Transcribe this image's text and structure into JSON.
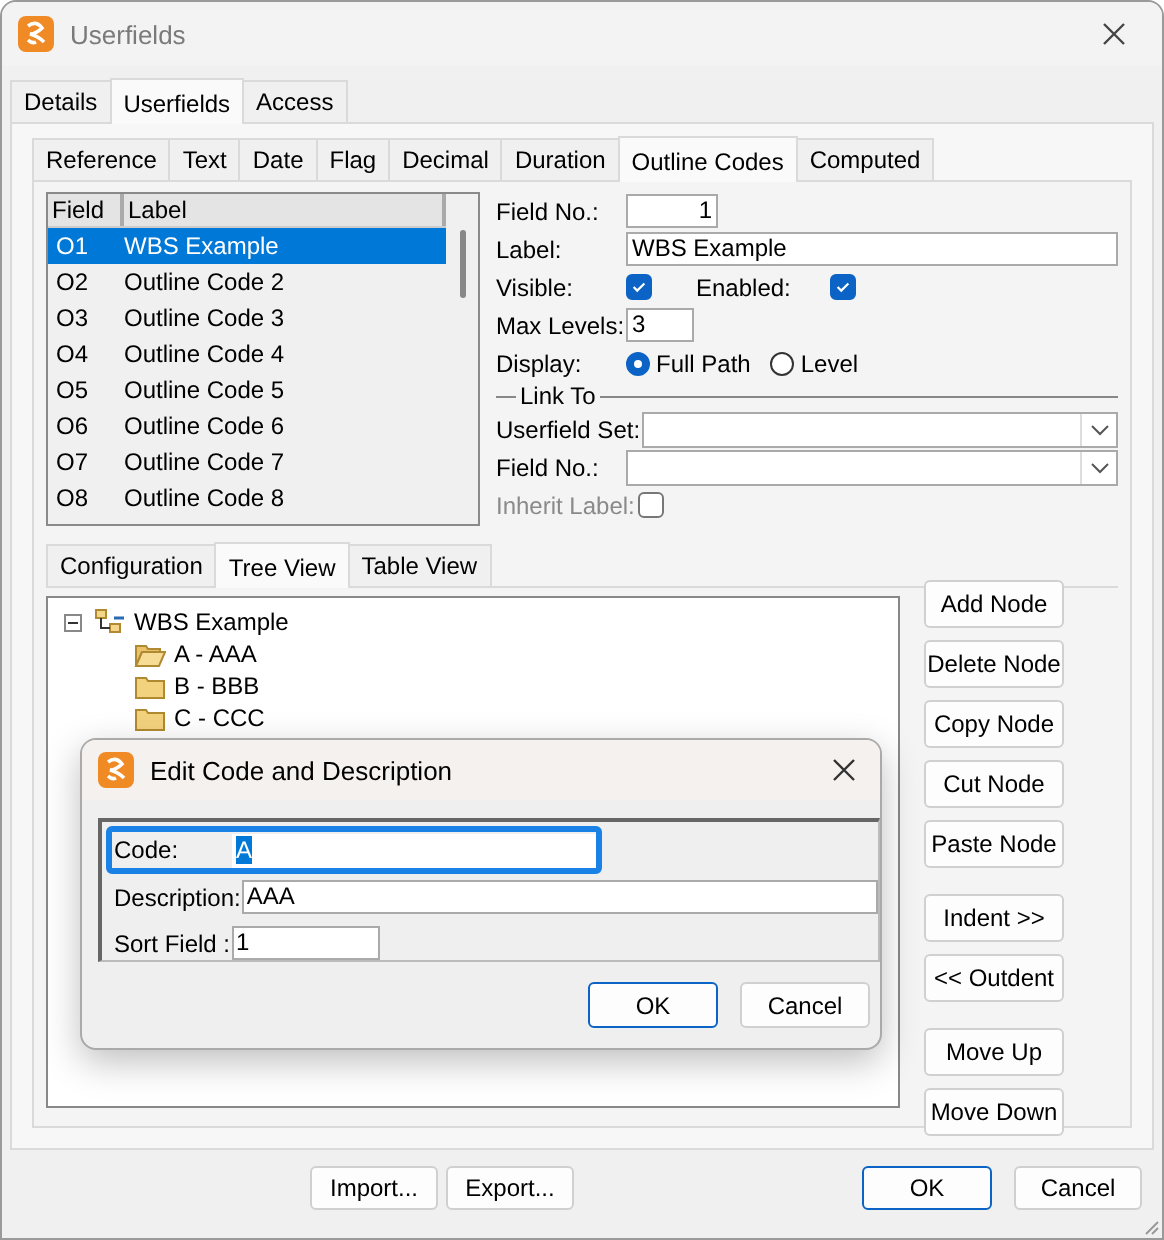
{
  "window": {
    "title": "Userfields"
  },
  "tabs": [
    {
      "label": "Details",
      "selected": false
    },
    {
      "label": "Userfields",
      "selected": true
    },
    {
      "label": "Access",
      "selected": false
    }
  ],
  "inner_tabs": [
    {
      "label": "Reference",
      "selected": false
    },
    {
      "label": "Text",
      "selected": false
    },
    {
      "label": "Date",
      "selected": false
    },
    {
      "label": "Flag",
      "selected": false
    },
    {
      "label": "Decimal",
      "selected": false
    },
    {
      "label": "Duration",
      "selected": false
    },
    {
      "label": "Outline Codes",
      "selected": true
    },
    {
      "label": "Computed",
      "selected": false
    }
  ],
  "field_list": {
    "columns": [
      "Field",
      "Label"
    ],
    "rows": [
      {
        "field": "O1",
        "label": "WBS Example",
        "selected": true
      },
      {
        "field": "O2",
        "label": "Outline Code 2",
        "selected": false
      },
      {
        "field": "O3",
        "label": "Outline Code 3",
        "selected": false
      },
      {
        "field": "O4",
        "label": "Outline Code 4",
        "selected": false
      },
      {
        "field": "O5",
        "label": "Outline Code 5",
        "selected": false
      },
      {
        "field": "O6",
        "label": "Outline Code 6",
        "selected": false
      },
      {
        "field": "O7",
        "label": "Outline Code 7",
        "selected": false
      },
      {
        "field": "O8",
        "label": "Outline Code 8",
        "selected": false
      }
    ]
  },
  "form": {
    "field_no": {
      "label": "Field No.:",
      "value": "1"
    },
    "label": {
      "label": "Label:",
      "value": "WBS Example"
    },
    "visible": {
      "label": "Visible:",
      "checked": true
    },
    "enabled": {
      "label": "Enabled:",
      "checked": true
    },
    "max_levels": {
      "label": "Max Levels:",
      "value": "3"
    },
    "display": {
      "label": "Display:",
      "options": [
        {
          "label": "Full Path",
          "selected": true
        },
        {
          "label": "Level",
          "selected": false
        }
      ]
    },
    "link_to": {
      "title": "Link To",
      "userfield_set": {
        "label": "Userfield Set:"
      },
      "field_no": {
        "label": "Field No.:"
      },
      "inherit": {
        "label": "Inherit Label:",
        "checked": false,
        "disabled": true
      }
    }
  },
  "view_tabs": [
    {
      "label": "Configuration",
      "selected": false
    },
    {
      "label": "Tree View",
      "selected": true
    },
    {
      "label": "Table View",
      "selected": false
    }
  ],
  "tree": {
    "label": "WBS Example",
    "expanded": true,
    "children": [
      {
        "label": "A - AAA",
        "open": true
      },
      {
        "label": "B - BBB",
        "open": false
      },
      {
        "label": "C - CCC",
        "open": false
      }
    ]
  },
  "node_buttons": [
    [
      "Add Node",
      "Delete Node",
      "Copy Node",
      "Cut Node",
      "Paste Node"
    ],
    [
      "Indent >>",
      "<< Outdent"
    ],
    [
      "Move Up",
      "Move Down"
    ]
  ],
  "dialog": {
    "title": "Edit Code and Description",
    "fields": [
      {
        "label": "Code:",
        "value": "A",
        "focused": true
      },
      {
        "label": "Description:",
        "value": "AAA",
        "focused": false
      },
      {
        "label": "Sort Field :",
        "value": "1",
        "focused": false
      }
    ],
    "buttons": [
      {
        "label": "OK",
        "default": true
      },
      {
        "label": "Cancel",
        "default": false
      }
    ]
  },
  "footer_buttons": [
    {
      "label": "Import...",
      "default": false
    },
    {
      "label": "Export...",
      "default": false
    },
    {
      "label": "OK",
      "default": true
    },
    {
      "label": "Cancel",
      "default": false
    }
  ]
}
